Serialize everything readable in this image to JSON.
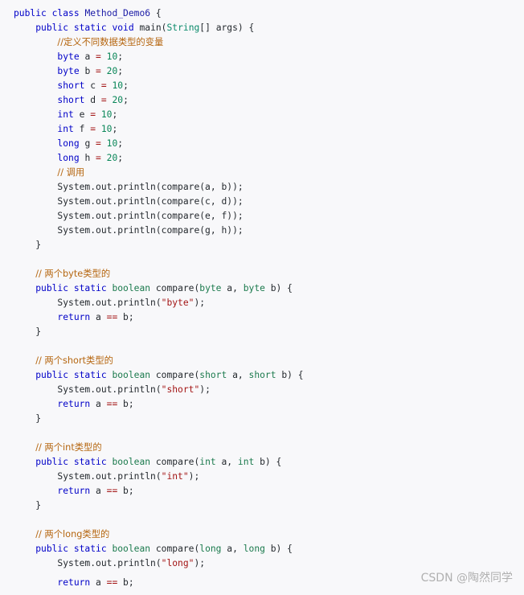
{
  "code": {
    "class_decl": {
      "kw": "public class",
      "name": "Method_Demo6",
      "rest": " {"
    },
    "main_decl": {
      "mods": "public static",
      "ret": "void",
      "name": " main(",
      "argtype": "String",
      "rest": "[] args) {"
    },
    "comment_vars": "//定义不同数据类型的变量",
    "vars": [
      {
        "type": "byte",
        "name": " a ",
        "eq": "=",
        "val": "10",
        "end": ";"
      },
      {
        "type": "byte",
        "name": " b ",
        "eq": "=",
        "val": "20",
        "end": ";"
      },
      {
        "type": "short",
        "name": " c ",
        "eq": "=",
        "val": "10",
        "end": ";"
      },
      {
        "type": "short",
        "name": " d ",
        "eq": "=",
        "val": "20",
        "end": ";"
      },
      {
        "type": "int",
        "name": " e ",
        "eq": "=",
        "val": "10",
        "end": ";"
      },
      {
        "type": "int",
        "name": " f ",
        "eq": "=",
        "val": "10",
        "end": ";"
      },
      {
        "type": "long",
        "name": " g ",
        "eq": "=",
        "val": "10",
        "end": ";"
      },
      {
        "type": "long",
        "name": " h ",
        "eq": "=",
        "val": "20",
        "end": ";"
      }
    ],
    "comment_call": "// 调用",
    "calls": [
      "System.out.println(compare(a, b));",
      "System.out.println(compare(c, d));",
      "System.out.println(compare(e, f));",
      "System.out.println(compare(g, h));"
    ],
    "close_brace": "}",
    "methods": [
      {
        "comment": "// 两个byte类型的",
        "type": "byte",
        "print": "System.out.println(",
        "str": "\"byte\"",
        "print_end": ");"
      },
      {
        "comment": "// 两个short类型的",
        "type": "short",
        "print": "System.out.println(",
        "str": "\"short\"",
        "print_end": ");"
      },
      {
        "comment": "// 两个int类型的",
        "type": "int",
        "print": "System.out.println(",
        "str": "\"int\"",
        "print_end": ");"
      },
      {
        "comment": "// 两个long类型的",
        "type": "long",
        "print": "System.out.println(",
        "str": "\"long\"",
        "print_end": ");"
      }
    ],
    "method_sig": {
      "mods": "public static",
      "ret": "boolean",
      "name": " compare(",
      "a": " a, ",
      "b": " b) {"
    },
    "ret": {
      "kw": "return",
      "lhs": " a ",
      "op": "==",
      "rhs": " b;"
    }
  },
  "watermark": "CSDN @陶然同学",
  "colors": {
    "background": "#f8f8fa",
    "keyword": "#0000c8",
    "type": "#0a8a6a",
    "comment": "#b5650e",
    "string": "#a31515",
    "number": "#098658"
  }
}
